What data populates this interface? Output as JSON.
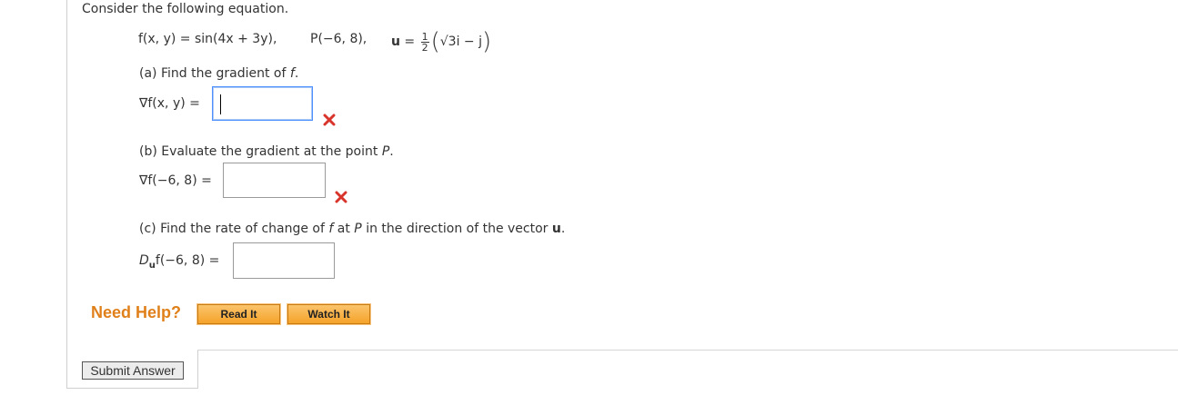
{
  "question": {
    "intro": "Consider the following equation.",
    "function": "f(x, y) = sin(4x + 3y),",
    "point": "P(−6, 8),",
    "vector_label": "u",
    "vector_eq": "=",
    "frac_num": "1",
    "frac_den": "2",
    "vector_body": "√3i − j"
  },
  "parts": {
    "a": {
      "prompt_prefix": "(a) Find the gradient of ",
      "prompt_var": "f",
      "prompt_suffix": ".",
      "lhs": "∇f(x, y)  =",
      "value": ""
    },
    "b": {
      "prompt_prefix": "(b) Evaluate the gradient at the point ",
      "prompt_var": "P",
      "prompt_suffix": ".",
      "lhs": "∇f(−6, 8)  =",
      "value": ""
    },
    "c": {
      "prompt_prefix": "(c) Find the rate of change of ",
      "prompt_var": "f",
      "prompt_mid": " at ",
      "prompt_var2": "P",
      "prompt_mid2": " in the direction of the vector ",
      "prompt_bold": "u",
      "prompt_suffix": ".",
      "lhs_main": "D",
      "lhs_sub": "u",
      "lhs_rest": "f(−6, 8)  =",
      "value": ""
    }
  },
  "help": {
    "label": "Need Help?",
    "read_label": "Read It",
    "watch_label": "Watch It"
  },
  "submit_label": "Submit Answer",
  "colors": {
    "help_orange": "#e0801a",
    "incorrect_red": "#d9342b",
    "focus_blue": "#4d90fe"
  },
  "icons": {
    "incorrect": "x-mark-icon"
  }
}
